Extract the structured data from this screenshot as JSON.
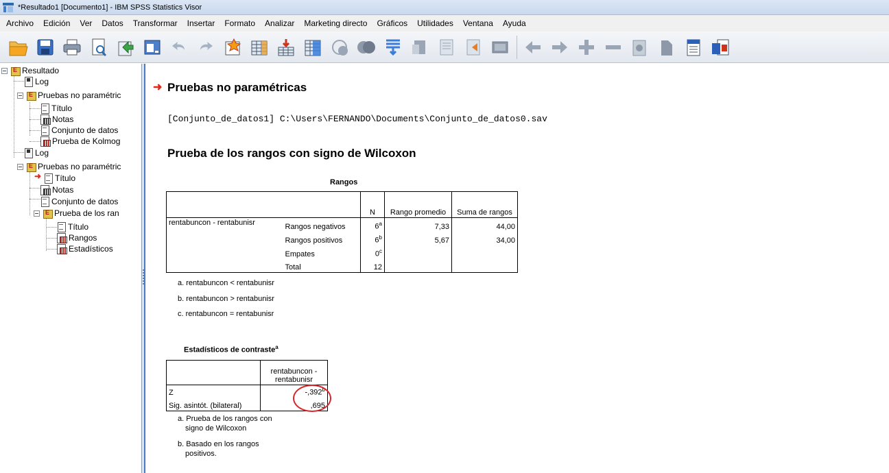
{
  "window": {
    "title": "*Resultado1 [Documento1] - IBM SPSS Statistics Visor"
  },
  "menu": [
    "Archivo",
    "Edición",
    "Ver",
    "Datos",
    "Transformar",
    "Insertar",
    "Formato",
    "Analizar",
    "Marketing directo",
    "Gráficos",
    "Utilidades",
    "Ventana",
    "Ayuda"
  ],
  "outline": {
    "root": "Resultado",
    "log1": "Log",
    "group1": "Pruebas no paramétric",
    "g1_title": "Título",
    "g1_notes": "Notas",
    "g1_dataset": "Conjunto de datos",
    "g1_test": "Prueba de Kolmog",
    "log2": "Log",
    "group2": "Pruebas no paramétric",
    "g2_title": "Título",
    "g2_notes": "Notas",
    "g2_dataset": "Conjunto de datos",
    "g2_sub": "Prueba de los ran",
    "sub_title": "Título",
    "sub_ranks": "Rangos",
    "sub_stats": "Estadísticos"
  },
  "content": {
    "heading": "Pruebas no paramétricas",
    "dataset_path": "[Conjunto_de_datos1] C:\\Users\\FERNANDO\\Documents\\Conjunto_de_datos0.sav",
    "subheading": "Prueba de los rangos con signo de Wilcoxon",
    "ranks": {
      "caption": "Rangos",
      "headers": {
        "n": "N",
        "mean_rank": "Rango promedio",
        "sum_ranks": "Suma de rangos"
      },
      "variable": "rentabuncon - rentabunisr",
      "rows": [
        {
          "label": "Rangos negativos",
          "n": "6",
          "sup": "a",
          "mean": "7,33",
          "sum": "44,00"
        },
        {
          "label": "Rangos positivos",
          "n": "6",
          "sup": "b",
          "mean": "5,67",
          "sum": "34,00"
        },
        {
          "label": "Empates",
          "n": "0",
          "sup": "c",
          "mean": "",
          "sum": ""
        },
        {
          "label": "Total",
          "n": "12",
          "sup": "",
          "mean": "",
          "sum": ""
        }
      ],
      "footnotes": [
        "a. rentabuncon < rentabunisr",
        "b. rentabuncon > rentabunisr",
        "c. rentabuncon = rentabunisr"
      ]
    },
    "stats": {
      "caption": "Estadísticos de contraste",
      "caption_sup": "a",
      "column": "rentabuncon - rentabunisr",
      "z_label": "Z",
      "z_value": "-,392",
      "z_sup": "b",
      "sig_label": "Sig. asintót. (bilateral)",
      "sig_value": ",695",
      "footnote_a1": "a. Prueba de los rangos con",
      "footnote_a2": "signo de Wilcoxon",
      "footnote_b1": "b. Basado en los rangos",
      "footnote_b2": "positivos."
    }
  }
}
